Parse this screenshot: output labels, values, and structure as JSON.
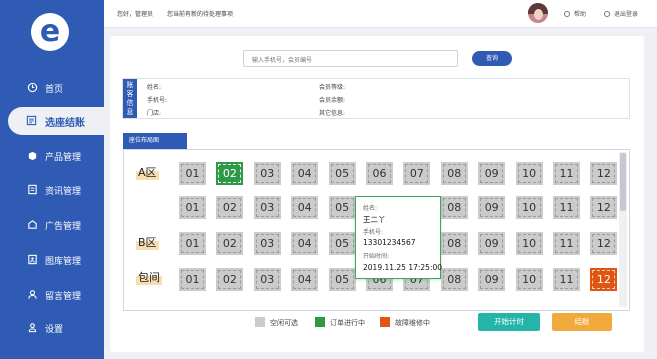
{
  "sidebar": {
    "logo_icon": "e-logo",
    "items": [
      {
        "label": "首页",
        "icon": "home-icon"
      },
      {
        "label": "选座结账",
        "icon": "checkout-icon",
        "active": true
      },
      {
        "label": "产品管理",
        "icon": "product-icon"
      },
      {
        "label": "资讯管理",
        "icon": "news-icon"
      },
      {
        "label": "广告管理",
        "icon": "ad-icon"
      },
      {
        "label": "图库管理",
        "icon": "gallery-icon"
      },
      {
        "label": "留言管理",
        "icon": "message-icon"
      },
      {
        "label": "设置",
        "icon": "settings-icon"
      }
    ]
  },
  "header": {
    "greeting": "您好，管理员",
    "notice": "您当前有新的待处理事项",
    "help": "帮助",
    "logout": "退出登录"
  },
  "search": {
    "placeholder": "输入手机号，会员编号",
    "button": "查询"
  },
  "member": {
    "tab": "账\n客\n信\n息",
    "name_label": "姓名:",
    "phone_label": "手机号:",
    "store_label": "门店:",
    "level_label": "会员等级:",
    "balance_label": "会员余额:",
    "other_label": "其它信息:"
  },
  "seats": {
    "tab": "座位布局图",
    "zones": {
      "a": "A区",
      "b": "B区",
      "vip": "包间"
    },
    "row_labels": [
      "01",
      "02",
      "03",
      "04",
      "05",
      "06",
      "07",
      "08",
      "09",
      "10",
      "11",
      "12"
    ],
    "busy_seat": "A区-02",
    "broken_seat": "包间-12"
  },
  "popup": {
    "name_label": "姓名:",
    "name": "王二丫",
    "phone_label": "手机号:",
    "phone": "13301234567",
    "time_label": "开始时间:",
    "time": "2019.11.25 17:25:00"
  },
  "legend": {
    "free": "空闲可选",
    "in_progress": "订单进行中",
    "fault": "故障维修中",
    "colors": {
      "free": "#cbcbcb",
      "in_progress": "#2e9a48",
      "fault": "#e05414"
    }
  },
  "actions": {
    "start": "开始计时",
    "checkout": "结账"
  },
  "colors": {
    "brand": "#2f5bb5",
    "start_btn": "#25b5a8",
    "checkout_btn": "#f2a93b"
  }
}
